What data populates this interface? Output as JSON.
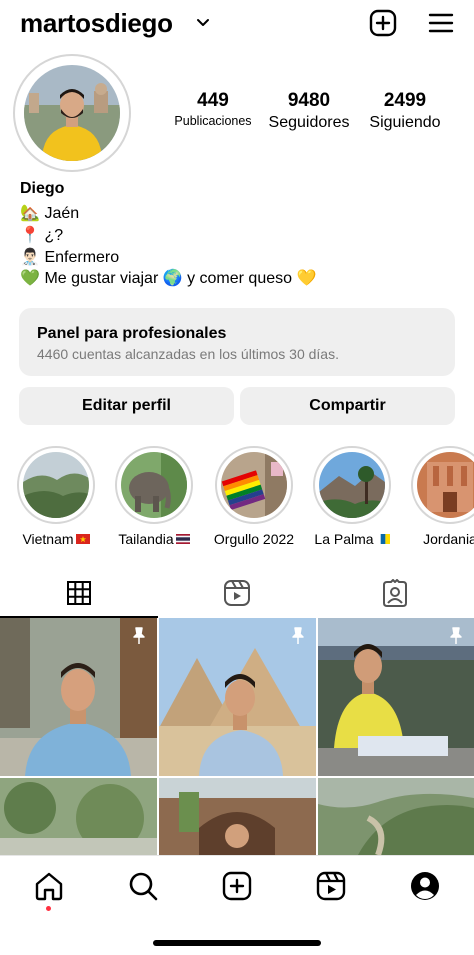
{
  "header": {
    "username": "martosdiego"
  },
  "stats": [
    {
      "value": "449",
      "label": "Publicaciones"
    },
    {
      "value": "9480",
      "label": "Seguidores"
    },
    {
      "value": "2499",
      "label": "Siguiendo"
    }
  ],
  "bio": {
    "name": "Diego",
    "lines": [
      {
        "emoji": "🏡",
        "text": "Jaén"
      },
      {
        "emoji": "📍",
        "text": "¿?"
      },
      {
        "emoji": "👨🏻‍⚕️",
        "text": "Enfermero"
      },
      {
        "emoji": "💚",
        "text": "Me gustar viajar 🌍 y comer queso 💛"
      }
    ]
  },
  "panel": {
    "title": "Panel para profesionales",
    "subtitle": "4460 cuentas alcanzadas en los últimos 30 días."
  },
  "buttons": {
    "edit": "Editar perfil",
    "share": "Compartir"
  },
  "highlights": [
    {
      "label": "Vietnam",
      "flag": "vietnam"
    },
    {
      "label": "Tailandia",
      "flag": "thailand"
    },
    {
      "label": "Orgullo 2022",
      "flag": ""
    },
    {
      "label": "La Palma",
      "flag": "canarias"
    },
    {
      "label": "Jordania",
      "flag": ""
    }
  ],
  "tabs": [
    "grid-icon",
    "reels-icon",
    "tagged-icon"
  ],
  "grid": [
    {
      "pinned": true
    },
    {
      "pinned": true
    },
    {
      "pinned": true
    },
    {
      "pinned": false
    },
    {
      "pinned": false
    },
    {
      "pinned": false
    }
  ],
  "bottom_nav": [
    "home-icon",
    "search-icon",
    "create-icon",
    "reels-icon",
    "profile-icon"
  ],
  "colors": {
    "accent_dot": "#ff3040",
    "secondary_text": "#7a7a7a",
    "panel_bg": "#efefef"
  }
}
